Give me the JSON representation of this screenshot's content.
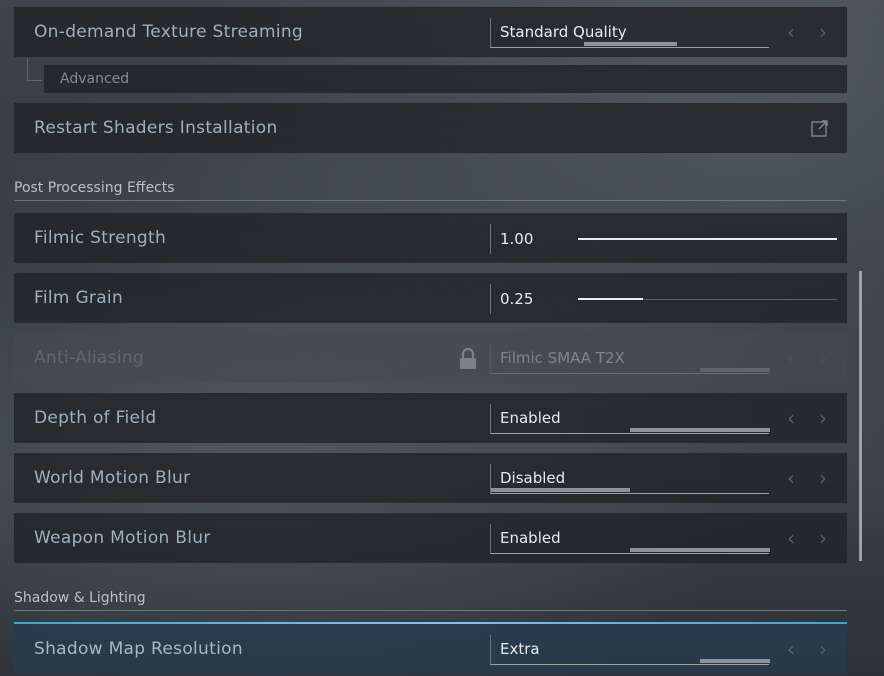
{
  "rows": {
    "texture_streaming": {
      "label": "On-demand Texture Streaming",
      "value": "Standard Quality",
      "indicator": 0.33
    },
    "advanced": {
      "label": "Advanced"
    },
    "restart_shaders": {
      "label": "Restart Shaders Installation"
    },
    "filmic_strength": {
      "label": "Filmic Strength",
      "value": "1.00",
      "slider": 1.0
    },
    "film_grain": {
      "label": "Film Grain",
      "value": "0.25",
      "slider": 0.25
    },
    "anti_aliasing": {
      "label": "Anti-Aliasing",
      "value": "Filmic SMAA T2X",
      "indicator": 0.25
    },
    "depth_of_field": {
      "label": "Depth of Field",
      "value": "Enabled",
      "indicator": 0.5
    },
    "world_motion_blur": {
      "label": "World Motion Blur",
      "value": "Disabled",
      "indicator": 0.5
    },
    "weapon_motion_blur": {
      "label": "Weapon Motion Blur",
      "value": "Enabled",
      "indicator": 0.5
    },
    "shadow_map_resolution": {
      "label": "Shadow Map Resolution",
      "value": "Extra",
      "indicator": 0.25
    }
  },
  "sections": {
    "post_processing": "Post Processing Effects",
    "shadow_lighting": "Shadow & Lighting"
  },
  "arrows": {
    "left": "‹",
    "right": "›"
  },
  "icons": {
    "external_link": "external-link-icon",
    "lock": "lock-icon"
  },
  "colors": {
    "accent": "#3fa3d6"
  }
}
